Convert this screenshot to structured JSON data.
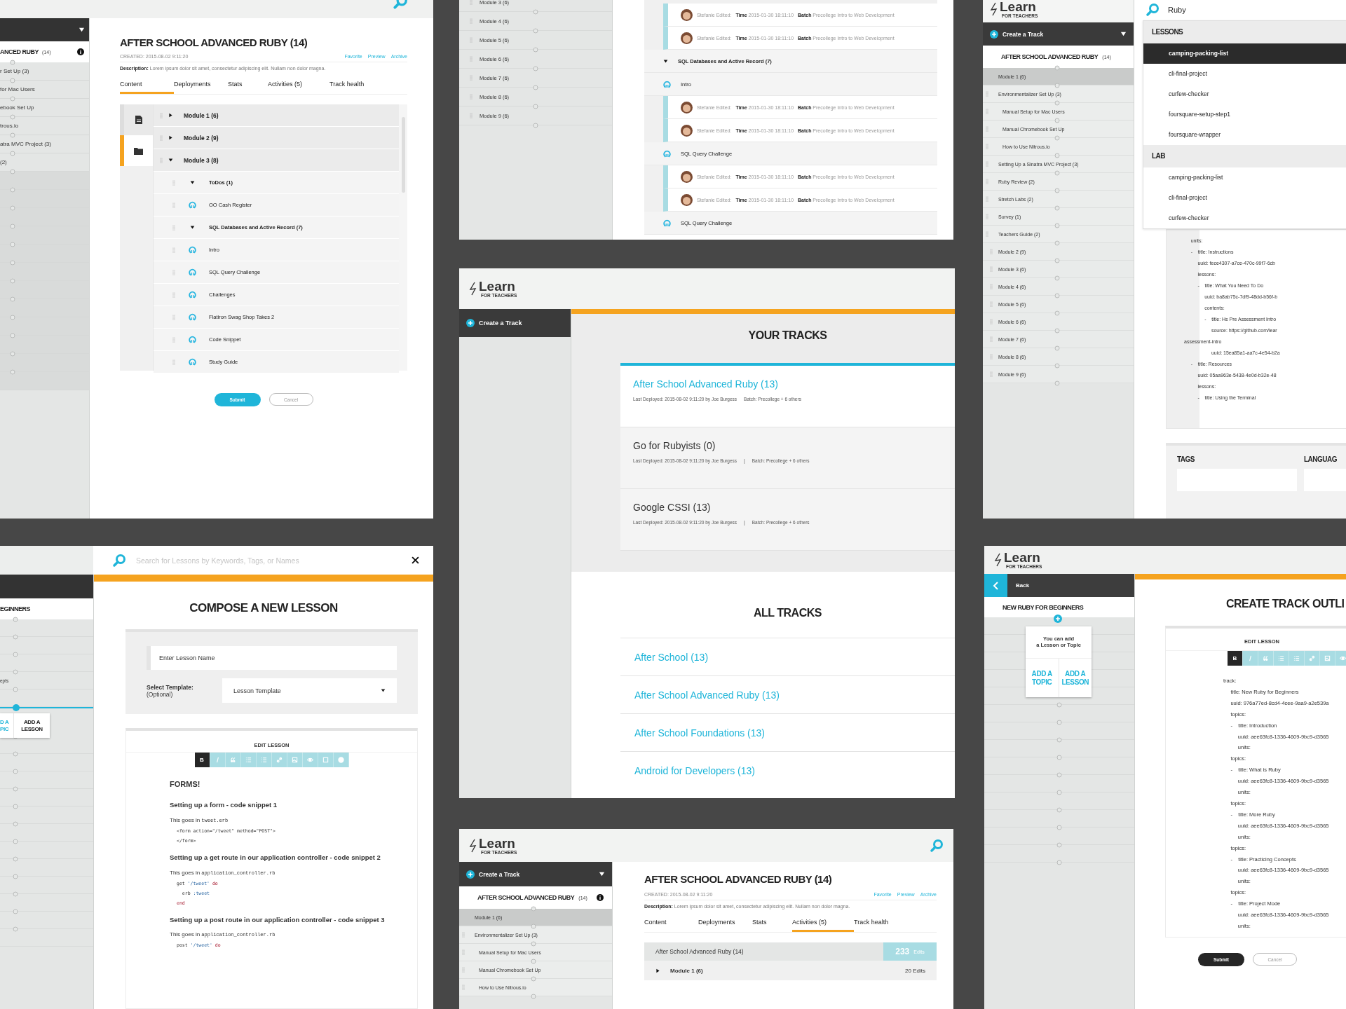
{
  "track_editor": {
    "sidebar": {
      "track_title": "ANCED RUBY",
      "track_count": "(14)",
      "items": [
        "r Set Up (3)",
        "for Mac Users",
        "ebook Set Up",
        "trous.io",
        "atra MVC Project (3)",
        "(2)"
      ]
    },
    "title": "AFTER SCHOOL ADVANCED RUBY (14)",
    "created": "CREATED: 2015-08-02 9:11:20",
    "links": [
      "Favorite",
      "Preview",
      "Archive"
    ],
    "description": "**Description:** Lorem ipsum dolor sit amet, consectetur adipiscing elit. Nullam non dolor magna.",
    "tabs": [
      {
        "label": "Content",
        "selected": true
      },
      {
        "label": "Deployments",
        "selected": false
      },
      {
        "label": "Stats",
        "selected": false
      },
      {
        "label": "Activities (5)",
        "selected": false
      },
      {
        "label": "Track health",
        "selected": false
      }
    ],
    "side_tabs": [
      {
        "kind": "file",
        "selected": false
      },
      {
        "kind": "folder",
        "selected": true
      }
    ],
    "outline": [
      {
        "kind": "module",
        "label": "Module 1 (6)",
        "expanded": false
      },
      {
        "kind": "module",
        "label": "Module 2 (9)",
        "expanded": false
      },
      {
        "kind": "module",
        "label": "Module 3 (8)",
        "expanded": true,
        "children": [
          {
            "kind": "topic",
            "label": "ToDos (1)",
            "expanded": true,
            "children": [
              {
                "kind": "lesson",
                "label": "OO Cash Register"
              }
            ]
          },
          {
            "kind": "topic",
            "label": "SQL Databases and Active Record (7)",
            "expanded": true,
            "children": [
              {
                "kind": "lesson",
                "label": "Intro"
              },
              {
                "kind": "lesson",
                "label": "SQL Query Challenge"
              },
              {
                "kind": "lesson",
                "label": "Challenges"
              },
              {
                "kind": "lesson",
                "label": "Flatiron Swag Shop Takes 2"
              },
              {
                "kind": "lesson",
                "label": "Code Snippet"
              },
              {
                "kind": "lesson",
                "label": "Study Guide"
              }
            ]
          }
        ]
      }
    ],
    "submit": "Submit",
    "cancel": "Cancel"
  },
  "activity_feed": {
    "modules": [
      "Module 3 (6)",
      "Module 4 (6)",
      "Module 5 (6)",
      "Module 6 (6)",
      "Module 7 (6)",
      "Module 8 (6)",
      "Module 9 (6)"
    ],
    "entries": [
      {
        "kind": "edit",
        "text": "Stefanie Edited: **Time** 2015-01-30 18:11:10 **Batch** Precollege Intro to Web Development"
      },
      {
        "kind": "edit",
        "text": "Stefanie Edited: **Time** 2015-01-30 18:11:10 **Batch** Precollege Intro to Web Development"
      },
      {
        "kind": "topic",
        "text": "SQL Databases and Active Record (7)"
      },
      {
        "kind": "lesson",
        "text": "Intro"
      },
      {
        "kind": "edit",
        "text": "Stefanie Edited: **Time** 2015-01-30 18:11:10 **Batch** Precollege Intro to Web Development"
      },
      {
        "kind": "edit",
        "text": "Stefanie Edited: **Time** 2015-01-30 18:11:10 **Batch** Precollege Intro to Web Development"
      },
      {
        "kind": "lesson",
        "text": "SQL Query Challenge"
      },
      {
        "kind": "edit",
        "text": "Stefanie Edited: **Time** 2015-01-30 18:11:10 **Batch** Precollege Intro to Web Development"
      },
      {
        "kind": "edit",
        "text": "Stefanie Edited: **Time** 2015-01-30 18:11:10 **Batch** Precollege Intro to Web Development"
      },
      {
        "kind": "lesson",
        "text": "SQL Query Challenge"
      }
    ]
  },
  "lesson_search": {
    "logo": {
      "name": "Learn",
      "tagline": "FOR TEACHERS"
    },
    "create_button": "Create a Track",
    "track": {
      "title": "AFTER SCHOOL ADVANCED RUBY",
      "count": "(14)"
    },
    "tree": [
      {
        "label": "Module 1 (6)",
        "expanded": true,
        "children": [
          {
            "label": "Environmentalizer Set Up (3)",
            "children": [
              {
                "label": "Manual Setup for Mac Users"
              },
              {
                "label": "Manual Chromebook Set Up"
              },
              {
                "label": "How to Use Nitrous.io"
              }
            ]
          },
          {
            "label": "Setting Up a Sinatra MVC Project (3)"
          },
          {
            "label": "Ruby Review (2)"
          },
          {
            "label": "Stretch Labs (2)"
          },
          {
            "label": "Survey (1)"
          },
          {
            "label": "Teachers Guide (2)"
          }
        ]
      },
      {
        "label": "Module 2 (9)",
        "expanded": false
      },
      {
        "label": "Module 3 (6)",
        "expanded": false
      },
      {
        "label": "Module 4 (6)",
        "expanded": false
      },
      {
        "label": "Module 5 (6)",
        "expanded": false
      },
      {
        "label": "Module 6 (6)",
        "expanded": false
      },
      {
        "label": "Module 7 (6)",
        "expanded": false
      },
      {
        "label": "Module 8 (6)",
        "expanded": false
      },
      {
        "label": "Module 9 (6)",
        "expanded": false
      }
    ],
    "search": {
      "value": "Ruby"
    },
    "results": [
      {
        "heading": "LESSONS",
        "items": [
          {
            "label": "camping-packing-list",
            "selected": true
          },
          {
            "label": "cli-final-project",
            "selected": false
          },
          {
            "label": "curfew-checker",
            "selected": false
          },
          {
            "label": "foursquare-setup-step1",
            "selected": false
          },
          {
            "label": "foursquare-wrapper",
            "selected": false
          }
        ]
      },
      {
        "heading": "LAB",
        "items": [
          {
            "label": "camping-packing-list",
            "selected": false
          },
          {
            "label": "cli-final-project",
            "selected": false
          },
          {
            "label": "curfew-checker",
            "selected": false
          }
        ]
      }
    ],
    "yaml": [
      "     units:",
      "     -    title: Instructions",
      "          uuid: fece4307-a7ce-470c-99f7-6cb",
      "          lessons:",
      "          -    title: What You Need To Do",
      "               uuid: ba8ab75c-7df9-48dd-b56f-b",
      "               contents:",
      "               -    title: Hs Pre Assessment Intro",
      "                    source: https://github.com/lear",
      "assessment-intro",
      "                    uuid: 15ea85a1-aa7c-4e54-b2a",
      "     -    title: Resources",
      "          uuid: 05aa963e-5438-4e0d-b32e-48",
      "          lessons:",
      "          -    title: Using the Terminal"
    ],
    "tags_heading": "TAGS",
    "languages_heading": "LANGUAG"
  },
  "tracks_overview": {
    "logo": {
      "name": "Learn",
      "tagline": "FOR TEACHERS"
    },
    "create_button": "Create a Track",
    "your_tracks": {
      "heading": "YOUR TRACKS",
      "items": [
        {
          "name": "After School Advanced Ruby (13)",
          "meta": "Last Deployed: 2015-08-02 9:11:20 by Joe Burgess",
          "batch": "Batch: Precollege + 6 others",
          "selected": true
        },
        {
          "name": "Go for Rubyists (0)",
          "meta": "Last Deployed: 2015-08-02 9:11:20 by Joe Burgess",
          "separator": "|",
          "batch": "Batch: Precollege + 6 others",
          "selected": false
        },
        {
          "name": "Google CSSI (13)",
          "meta": "Last Deployed: 2015-08-02 9:11:20 by Joe Burgess",
          "separator": "|",
          "batch": "Batch: Precollege + 6 others",
          "selected": false
        }
      ]
    },
    "all_tracks": {
      "heading": "ALL TRACKS",
      "items": [
        "After School (13)",
        "After School Advanced Ruby (13)",
        "After School Foundations (13)",
        "Android for Developers (13)"
      ]
    }
  },
  "compose_lesson": {
    "search": {
      "placeholder": "Search for Lessons by Keywords, Tags, or Names"
    },
    "sidebar": {
      "track_title": "EGINNERS",
      "items": [
        "epts"
      ],
      "popup": {
        "topic": [
          "D A",
          "PIC"
        ],
        "lesson": [
          "ADD A",
          "LESSON"
        ]
      }
    },
    "title": "COMPOSE A NEW LESSON",
    "name_field": {
      "placeholder": "Enter Lesson Name"
    },
    "template": {
      "label": "Select Template:",
      "hint": "(Optional)",
      "value": "Lesson Template"
    },
    "editor": {
      "heading": "EDIT LESSON",
      "toolbar": [
        {
          "kind": "bold",
          "label": "B",
          "selected": true
        },
        {
          "kind": "italic",
          "selected": false
        },
        {
          "kind": "quote",
          "selected": false
        },
        {
          "kind": "bullets",
          "selected": false
        },
        {
          "kind": "numbers",
          "selected": false
        },
        {
          "kind": "link",
          "selected": false
        },
        {
          "kind": "image",
          "selected": false
        },
        {
          "kind": "preview",
          "selected": false
        },
        {
          "kind": "fullscreen",
          "selected": false
        },
        {
          "kind": "help",
          "selected": false
        }
      ],
      "content": [
        {
          "kind": "title",
          "text": "FORMS!"
        },
        {
          "kind": "heading",
          "text": "Setting up a form - code snippet 1"
        },
        {
          "kind": "note",
          "text": "This goes in",
          "code": "tweet.erb"
        },
        {
          "kind": "code",
          "lines": [
            [
              {
                "kind": "plain",
                "text": "<form action=\"/tweet\" method=\"POST\">"
              }
            ],
            [
              {
                "kind": "plain",
                "text": "</form>"
              }
            ]
          ]
        },
        {
          "kind": "heading",
          "text": "Setting up a get route in our application controller - code snippet 2"
        },
        {
          "kind": "note",
          "text": "This goes in",
          "code": "application_controller.rb"
        },
        {
          "kind": "code",
          "lines": [
            [
              {
                "kind": "plain",
                "text": "get "
              },
              {
                "kind": "string",
                "text": "'/tweet'"
              },
              {
                "kind": "keyword",
                "text": " do"
              }
            ],
            [
              {
                "kind": "plain",
                "text": "  erb "
              },
              {
                "kind": "symbol",
                "text": ":tweet"
              }
            ],
            [
              {
                "kind": "keyword",
                "text": "end"
              }
            ]
          ]
        },
        {
          "kind": "heading",
          "text": "Setting up a post route in our application controller - code snippet 3"
        },
        {
          "kind": "note",
          "text": "This goes in",
          "code": "application_controller.rb"
        },
        {
          "kind": "code",
          "lines": [
            [
              {
                "kind": "plain",
                "text": "post "
              },
              {
                "kind": "string",
                "text": "'/tweet'"
              },
              {
                "kind": "keyword",
                "text": " do"
              }
            ]
          ]
        }
      ]
    }
  },
  "track_activities": {
    "logo": {
      "name": "Learn",
      "tagline": "FOR TEACHERS"
    },
    "create_button": "Create a Track",
    "track": {
      "title": "AFTER SCHOOL ADVANCED RUBY",
      "count": "(14)"
    },
    "tree": [
      {
        "label": "Module 1 (6)",
        "expanded": true,
        "children": [
          {
            "label": "Environmentalizer Set Up (3)",
            "children": [
              {
                "label": "Manual Setup for Mac Users"
              },
              {
                "label": "Manual Chromebook Set Up"
              },
              {
                "label": "How to Use Nitrous.io"
              }
            ]
          }
        ]
      }
    ],
    "title": "AFTER SCHOOL ADVANCED RUBY (14)",
    "created": "CREATED: 2015-08-02 9:11:20",
    "links": [
      "Favorite",
      "Preview",
      "Archive"
    ],
    "description": "**Description:** Lorem ipsum dolor sit amet, consectetur adipiscing elit. Nullam non dolor magna.",
    "tabs": [
      {
        "label": "Content",
        "selected": false
      },
      {
        "label": "Deployments",
        "selected": false
      },
      {
        "label": "Stats",
        "selected": false
      },
      {
        "label": "Activities (5)",
        "selected": true
      },
      {
        "label": "Track health",
        "selected": false
      }
    ],
    "summary": {
      "label": "After School Advanced Ruby (14)",
      "count": "233",
      "unit": "Edits"
    },
    "modules": [
      {
        "label": "Module 1 (6)",
        "edits": "20 Edits",
        "expanded": false
      }
    ]
  },
  "track_outline": {
    "logo": {
      "name": "Learn",
      "tagline": "FOR TEACHERS"
    },
    "back": "Back",
    "track_title": "NEW RUBY FOR BEGINNERS",
    "popup": {
      "message": [
        "You can add",
        "a Lesson or Topic"
      ],
      "topic": [
        "ADD A",
        "TOPIC"
      ],
      "lesson": [
        "ADD A",
        "LESSON"
      ]
    },
    "title": "CREATE TRACK OUTLI",
    "editor": {
      "heading": "EDIT LESSON",
      "toolbar": [
        {
          "kind": "bold",
          "label": "B",
          "selected": true
        },
        {
          "kind": "italic",
          "selected": false
        },
        {
          "kind": "quote",
          "selected": false
        },
        {
          "kind": "bullets",
          "selected": false
        },
        {
          "kind": "numbers",
          "selected": false
        },
        {
          "kind": "link",
          "selected": false
        },
        {
          "kind": "image",
          "selected": false
        },
        {
          "kind": "preview",
          "selected": false
        }
      ]
    },
    "yaml": [
      "track:",
      "     title: New Ruby for Beginners",
      "     uuid: 976a77ed-8cd4-4cee-9aa9-a2e539a",
      "     topics:",
      "     -    title: Introduction",
      "          uuid: aee63fc8-1336-4609-9bc9-d3565",
      "          units:",
      "     topics:",
      "     -    title: What is Ruby",
      "          uuid: aee63fc8-1336-4609-9bc9-d3565",
      "          units:",
      "     topics:",
      "     -    title: More Ruby",
      "          uuid: aee63fc8-1336-4609-9bc9-d3565",
      "          units:",
      "     topics:",
      "     -    title: Practicing Concepts",
      "          uuid: aee63fc8-1336-4609-9bc9-d3565",
      "          units:",
      "     topics:",
      "     -    title: Project Mode",
      "          uuid: aee63fc8-1336-4609-9bc9-d3565",
      "          units:"
    ],
    "submit": "Submit",
    "cancel": "Cancel"
  }
}
